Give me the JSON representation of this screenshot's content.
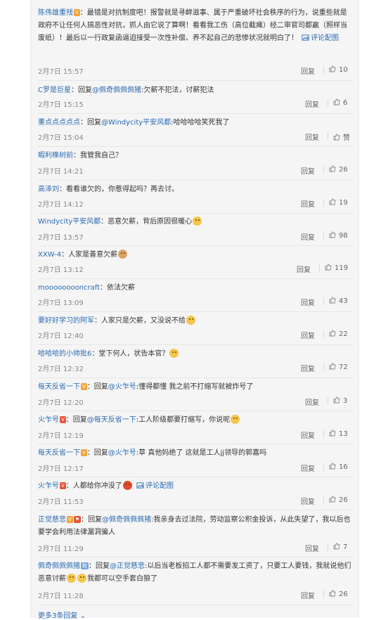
{
  "ui": {
    "reply_label": "回复",
    "praise_label": "赞",
    "more_replies": "更多3条回复",
    "pic_link": "评论配图"
  },
  "comments": [
    {
      "user": "陈伟雄重残",
      "text": "：最错是对抗制度吧！报警就是寻衅滋事、属于严重破坏社会秩序的行为，说重些就是政府不让任何人搞恶性对抗，抓人由它说了算啊！看看我工伤（高位截瘫）经二审官司都赢（照样当废纸）！最后以一行政复函逼迫接受一次性补偿、养不起自己的悲惨状况就明白了！",
      "time": "2月7日 15:57",
      "likes": "10"
    },
    {
      "user": "C罗是巨星",
      "reply_prefix": "：回复",
      "at": "@佩奇佩佩佩猪",
      "text": ":欠薪不犯法，讨薪犯法",
      "time": "2月7日 15:15",
      "likes": "6"
    },
    {
      "user": "董点点点点点",
      "reply_prefix": "：回复",
      "at": "@Windycity平安风都",
      "text": ":哈哈哈哈笑死我了",
      "time": "2月7日 15:04",
      "likes": "赞"
    },
    {
      "user": "暇利橡树前",
      "text": "：我管我自己？",
      "time": "2月7日 14:21",
      "likes": "26"
    },
    {
      "user": "高泽刘",
      "text": "：看看谁欠的，你惹得起吗？再去讨。",
      "time": "2月7日 14:12",
      "likes": "19"
    },
    {
      "user": "Windycity平安风都",
      "text": "：恶意欠薪，背后原因很暖心",
      "time": "2月7日 13:57",
      "likes": "98"
    },
    {
      "user": "XXW-4",
      "text": "：人家是善意欠薪",
      "time": "2月7日 13:12",
      "likes": "119"
    },
    {
      "user": "mooooooooncraft",
      "text": "：依法欠薪",
      "time": "2月7日 13:09",
      "likes": "43"
    },
    {
      "user": "要好好学习的阿军",
      "text": "：人家只是欠薪，又没说不给",
      "time": "2月7日 12:40",
      "likes": "22"
    },
    {
      "user": "哈哈哈的小帅批6",
      "text": "：堂下何人，状告本官？",
      "time": "2月7日 12:32",
      "likes": "72"
    },
    {
      "user": "每天反省一下",
      "reply_prefix": "：回复",
      "at": "@火乍号",
      "text": ":懂得都懂 我之前不打缩写就被炸号了",
      "time": "2月7日 12:20",
      "likes": "3"
    },
    {
      "user": "火乍号",
      "reply_prefix": "：回复",
      "at": "@每天反省一下",
      "text": ":工人阶级都要打缩写，你说呢",
      "time": "2月7日 12:19",
      "likes": "13"
    },
    {
      "user": "每天反省一下",
      "reply_prefix": "：回复",
      "at": "@火乍号",
      "text": ":草 真他妈绝了 这就是工人jj领导的郭嘉吗",
      "time": "2月7日 12:17",
      "likes": "16"
    },
    {
      "user": "火乍号",
      "text": "：人都给你冲没了",
      "time": "2月7日 11:53",
      "likes": "26"
    },
    {
      "user": "正觉慈悲",
      "reply_prefix": "：回复",
      "at": "@佩奇佩佩佩猪",
      "text": ":我亲身去过法院，劳动监察公积金投诉，从此失望了，我以后也要学会利用法律漏洞骗人",
      "time": "2月7日 11:29",
      "likes": "7"
    },
    {
      "user": "佩奇佩佩佩猪",
      "reply_prefix": "：回复",
      "at": "@正觉慈悲",
      "text": ":以后当老板招工人都不需要发工资了，只要工人要钱，我就说他们恶意讨薪",
      "text2": "我都可以空手套白狼了",
      "time": "2月7日 11:28",
      "likes": "26"
    }
  ]
}
